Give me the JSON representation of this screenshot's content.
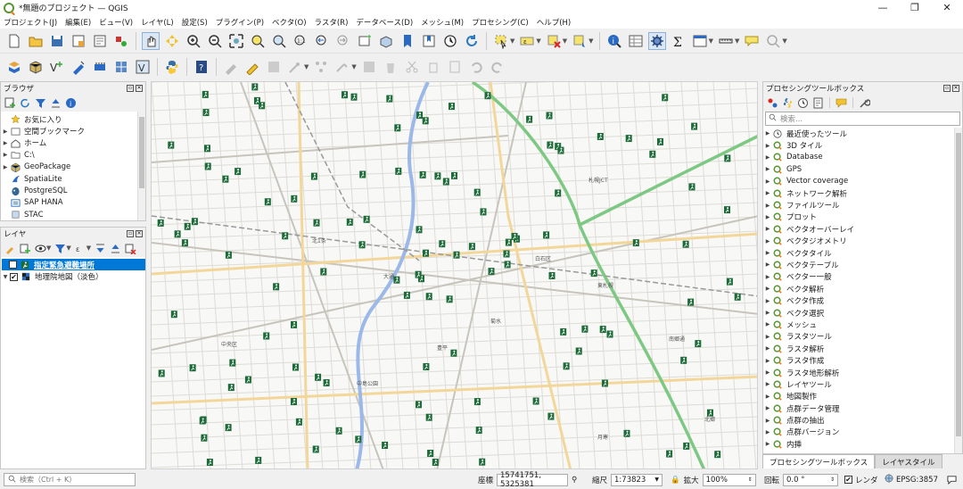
{
  "window": {
    "title": "*無題のプロジェクト — QGIS",
    "min": "—",
    "max": "❐",
    "close": "✕"
  },
  "menu": [
    "プロジェクト(J)",
    "編集(E)",
    "ビュー(V)",
    "レイヤ(L)",
    "設定(S)",
    "プラグイン(P)",
    "ベクタ(O)",
    "ラスタ(R)",
    "データベース(D)",
    "メッシュ(M)",
    "プロセシング(C)",
    "ヘルプ(H)"
  ],
  "browser": {
    "title": "ブラウザ",
    "items": [
      {
        "label": "お気に入り",
        "icon": "star-icon",
        "expand": ""
      },
      {
        "label": "空間ブックマーク",
        "icon": "bookmark-icon",
        "expand": "▶"
      },
      {
        "label": "ホーム",
        "icon": "home-icon",
        "expand": "▶"
      },
      {
        "label": "C:\\",
        "icon": "drive-icon",
        "expand": "▶"
      },
      {
        "label": "GeoPackage",
        "icon": "geopackage-icon",
        "expand": "▶"
      },
      {
        "label": "SpatiaLite",
        "icon": "spatialite-icon",
        "expand": ""
      },
      {
        "label": "PostgreSQL",
        "icon": "postgresql-icon",
        "expand": ""
      },
      {
        "label": "SAP HANA",
        "icon": "saphana-icon",
        "expand": ""
      },
      {
        "label": "STAC",
        "icon": "stac-icon",
        "expand": ""
      }
    ]
  },
  "layers": {
    "title": "レイヤ",
    "items": [
      {
        "label": "指定緊急避難場所",
        "checked": "✔",
        "selected": true
      },
      {
        "label": "地理院地図（淡色）",
        "checked": "✔",
        "selected": false
      }
    ]
  },
  "processing": {
    "title": "プロセシングツールボックス",
    "search_placeholder": "検索...",
    "items": [
      "最近使ったツール",
      "3D タイル",
      "Database",
      "GPS",
      "Vector coverage",
      "ネットワーク解析",
      "ファイルツール",
      "プロット",
      "ベクタオーバーレイ",
      "ベクタジオメトリ",
      "ベクタタイル",
      "ベクタテーブル",
      "ベクター一般",
      "ベクタ解析",
      "ベクタ作成",
      "ベクタ選択",
      "メッシュ",
      "ラスタツール",
      "ラスタ解析",
      "ラスタ作成",
      "ラスタ地形解析",
      "レイヤツール",
      "地図製作",
      "点群データ管理",
      "点群の抽出",
      "点群バージョン",
      "内挿"
    ]
  },
  "tabs": {
    "toolbox": "プロセシングツールボックス",
    "style": "レイヤスタイル"
  },
  "map": {
    "labels": [
      "中央区",
      "白石区",
      "北1条",
      "大通",
      "札幌JCT",
      "中島公園",
      "南郷通",
      "北郷",
      "豊平",
      "月寒",
      "菊水",
      "東札幌"
    ]
  },
  "status": {
    "search_placeholder": "検索（Ctrl + K）",
    "coord_label": "座標",
    "coord_value": "15741751, 5325381",
    "scale_label": "縮尺",
    "scale_value": "1:73823",
    "magnify_label": "拡大",
    "magnify_value": "100%",
    "rotation_label": "回転",
    "rotation_value": "0.0 °",
    "render_label": "レンダ",
    "crs": "EPSG:3857"
  },
  "colors": {
    "accent": "#3399ff",
    "selected_row": "#0078d7",
    "shelter": "#1e6b3a",
    "river": "#9bb8e8",
    "rail": "#7dc883",
    "road": "#f3d79a"
  }
}
